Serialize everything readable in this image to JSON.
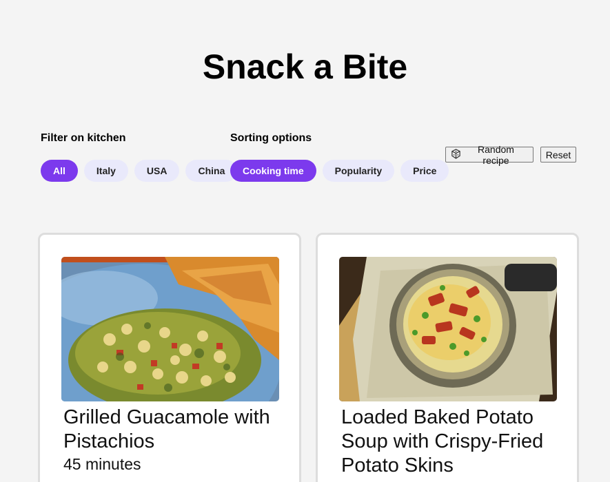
{
  "header": {
    "title": "Snack a Bite"
  },
  "filter": {
    "label": "Filter on kitchen",
    "options": [
      {
        "label": "All",
        "active": true
      },
      {
        "label": "Italy",
        "active": false
      },
      {
        "label": "USA",
        "active": false
      },
      {
        "label": "China",
        "active": false
      }
    ]
  },
  "sorting": {
    "label": "Sorting options",
    "options": [
      {
        "label": "Cooking time",
        "active": true
      },
      {
        "label": "Popularity",
        "active": false
      },
      {
        "label": "Price",
        "active": false
      }
    ]
  },
  "actions": {
    "random_label": "Random recipe",
    "random_icon": "dice-icon",
    "reset_label": "Reset"
  },
  "recipes": [
    {
      "title": "Grilled Guacamole with Pistachios",
      "time": "45 minutes"
    },
    {
      "title": "Loaded Baked Potato Soup with Crispy-Fried Potato Skins",
      "time": ""
    }
  ],
  "colors": {
    "accent": "#7c3aed",
    "pill": "#e9e9fb",
    "background": "#f4f4f4"
  }
}
